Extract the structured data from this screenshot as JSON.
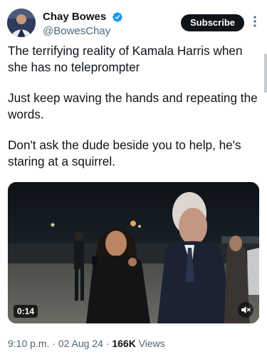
{
  "author": {
    "display_name": "Chay Bowes",
    "handle": "@BowesChay",
    "verified_icon": "verified-badge-icon"
  },
  "actions": {
    "subscribe_label": "Subscribe",
    "more_icon": "more-vertical-icon"
  },
  "tweet": {
    "paragraphs": [
      "The terrifying reality of Kamala Harris when she has no teleprompter",
      "Just keep waving the hands and repeating the words.",
      "Don't ask the dude beside you to help, he's staring at a squirrel."
    ]
  },
  "media": {
    "type": "video",
    "duration": "0:14",
    "mute_icon": "volume-muted-icon"
  },
  "meta": {
    "time": "9:10 p.m.",
    "separator": "·",
    "date": "02 Aug 24",
    "views_count": "166K",
    "views_label": "Views"
  },
  "colors": {
    "text": "#0f1419",
    "secondary_text": "#536471",
    "verified_blue": "#1d9bf0",
    "subscribe_bg": "#0f1419"
  }
}
